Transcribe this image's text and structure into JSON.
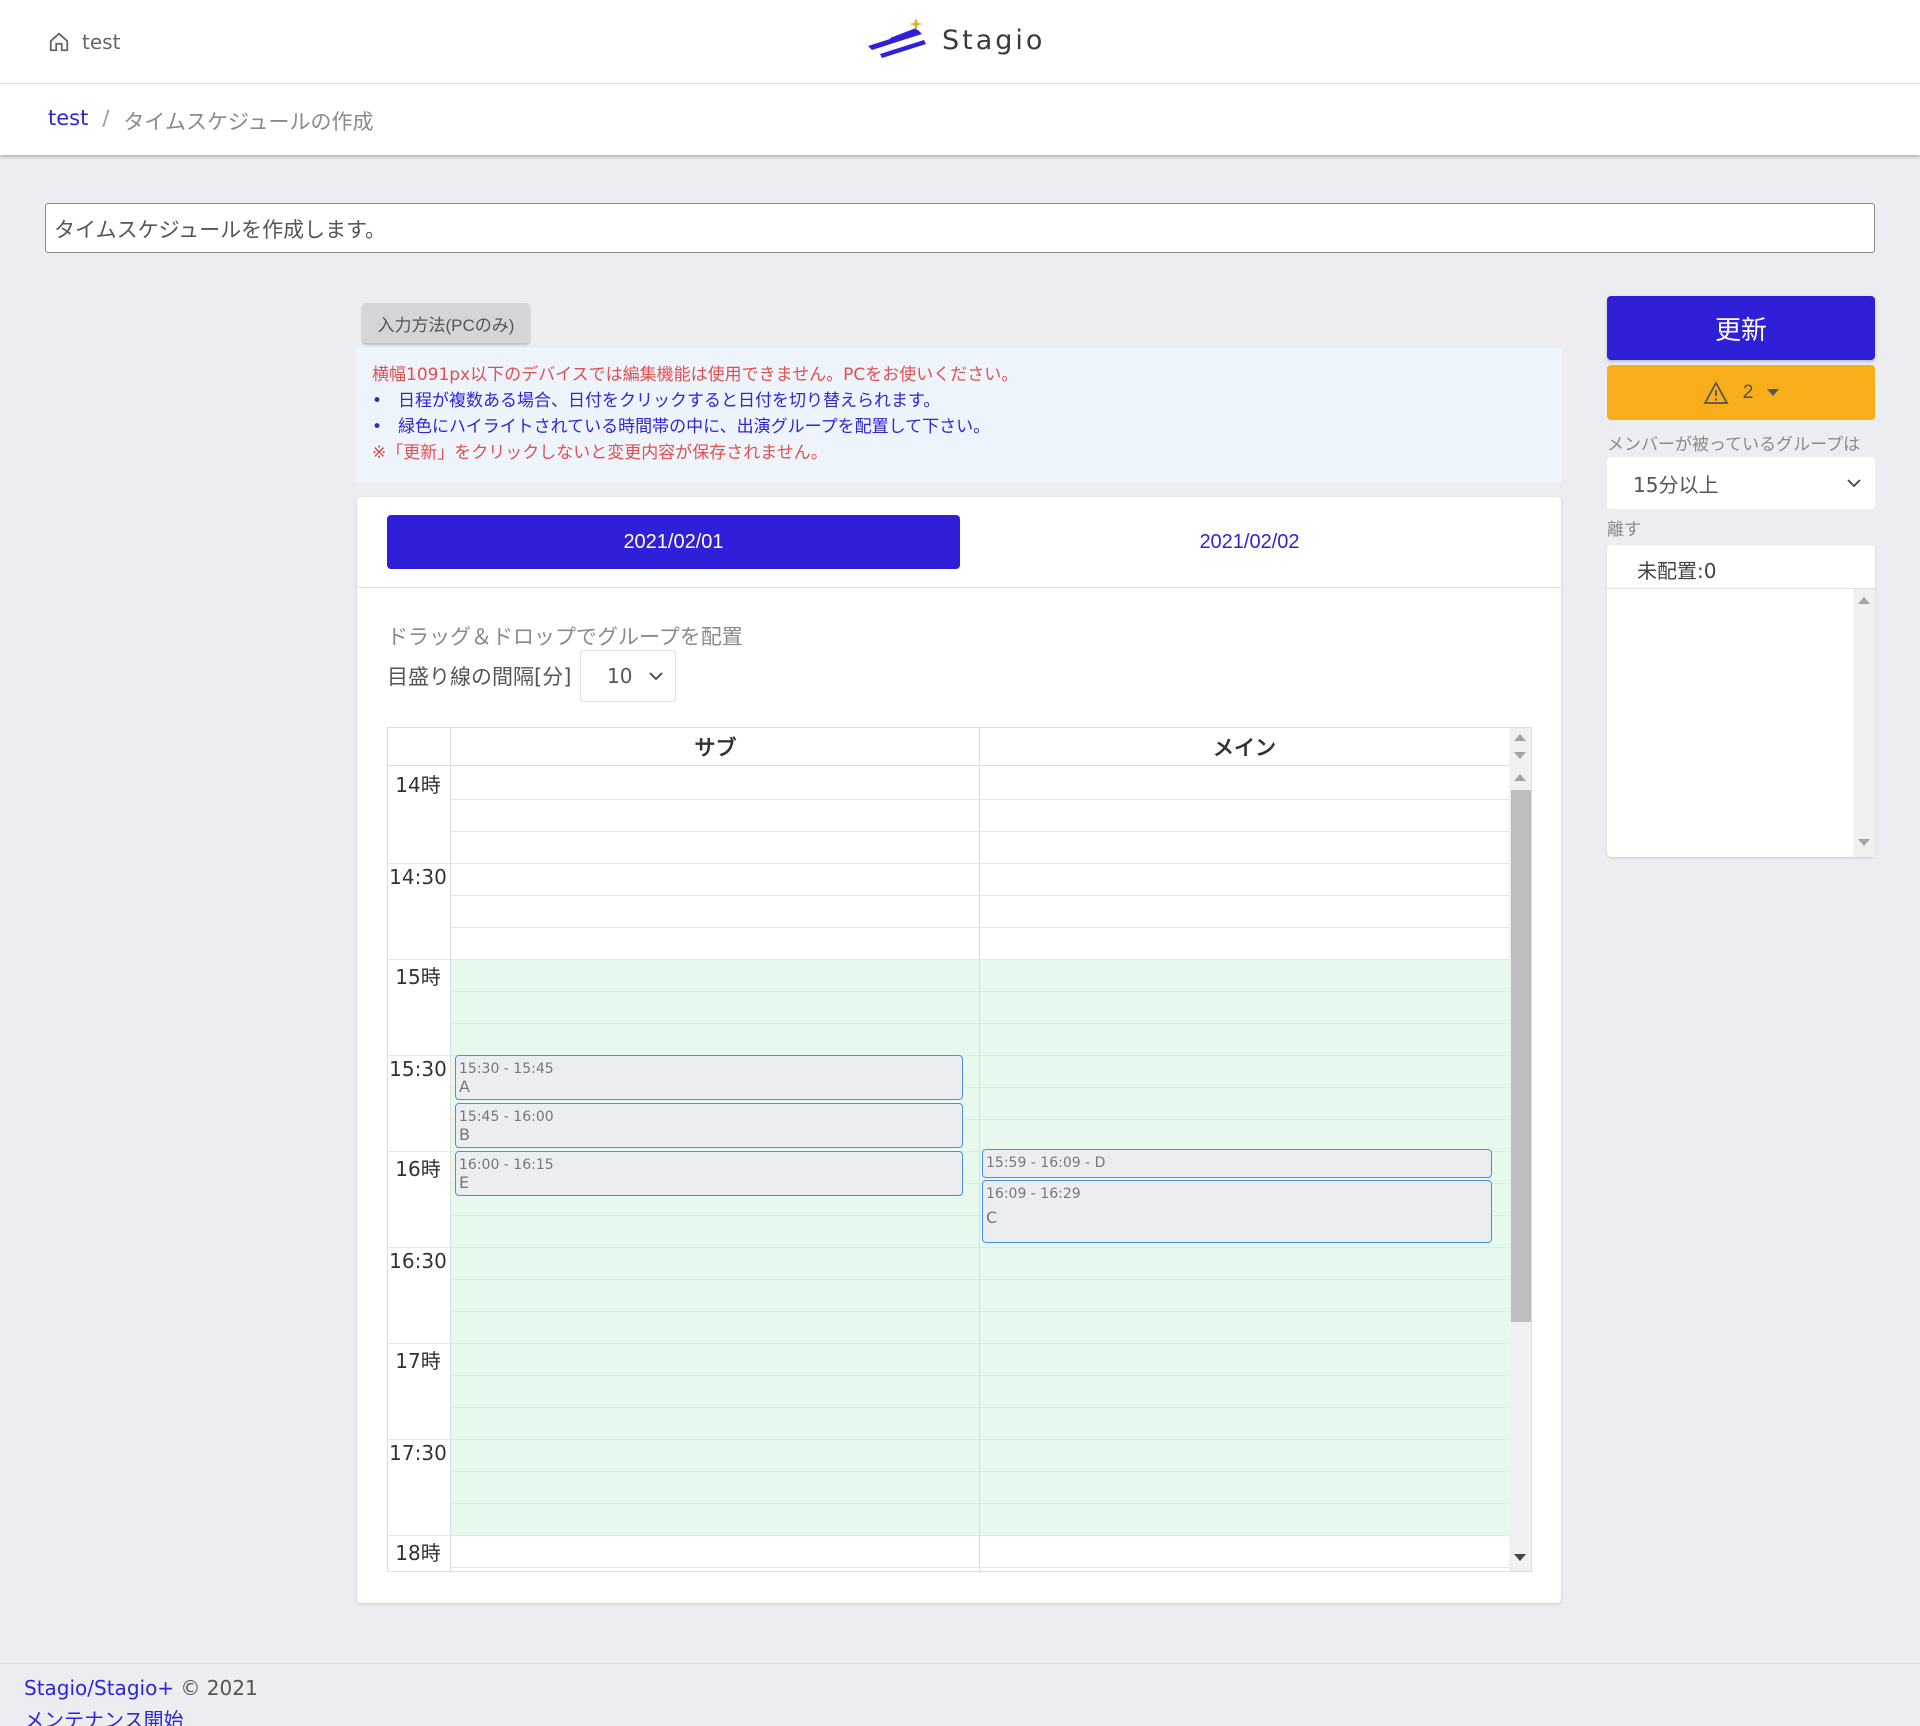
{
  "header": {
    "home_label": "test",
    "logo_text": "Stagio"
  },
  "breadcrumb": {
    "link": "test",
    "separator": "/",
    "current": "タイムスケジュールの作成"
  },
  "description": "タイムスケジュールを作成します。",
  "input_method_button": "入力方法(PCのみ)",
  "notice": {
    "warning": "横幅1091px以下のデバイスでは編集機能は使用できません。PCをお使いください。",
    "bullets": [
      "日程が複数ある場合、日付をクリックすると日付を切り替えられます。",
      "緑色にハイライトされている時間帯の中に、出演グループを配置して下さい。"
    ],
    "save_note": "※「更新」をクリックしないと変更内容が保存されません。"
  },
  "date_tabs": [
    "2021/02/01",
    "2021/02/02"
  ],
  "active_tab": "2021/02/01",
  "dnd_hint": "ドラッグ＆ドロップでグループを配置",
  "interval": {
    "label": "目盛り線の間隔[分]",
    "value": "10"
  },
  "schedule": {
    "stages": [
      "サブ",
      "メイン"
    ],
    "time_labels": [
      "14時",
      "14:30",
      "15時",
      "15:30",
      "16時",
      "16:30",
      "17時",
      "17:30",
      "18時"
    ],
    "highlight": {
      "start": "15:00",
      "end": "17:50"
    },
    "events": [
      {
        "stage": "サブ",
        "time": "15:30 - 15:45",
        "name": "A"
      },
      {
        "stage": "サブ",
        "time": "15:45 - 16:00",
        "name": "B"
      },
      {
        "stage": "サブ",
        "time": "16:00 - 16:15",
        "name": "E"
      },
      {
        "stage": "メイン",
        "time": "15:59 - 16:09 - D",
        "name": ""
      },
      {
        "stage": "メイン",
        "time": "16:09 - 16:29",
        "name": "C"
      }
    ]
  },
  "sidebar": {
    "update_button": "更新",
    "warning_count": "2",
    "overlap_label": "メンバーが被っているグループは",
    "overlap_value": "15分以上",
    "separate_label": "離す",
    "unplaced_label": "未配置:0"
  },
  "footer": {
    "brand": "Stagio/Stagio+",
    "copyright": "© 2021",
    "maintenance": "メンテナンス開始"
  },
  "colors": {
    "primary": "#2f1fd9",
    "warning": "#f8ad1a",
    "highlight": "#e6f9ec",
    "notice_red": "#e05050"
  }
}
